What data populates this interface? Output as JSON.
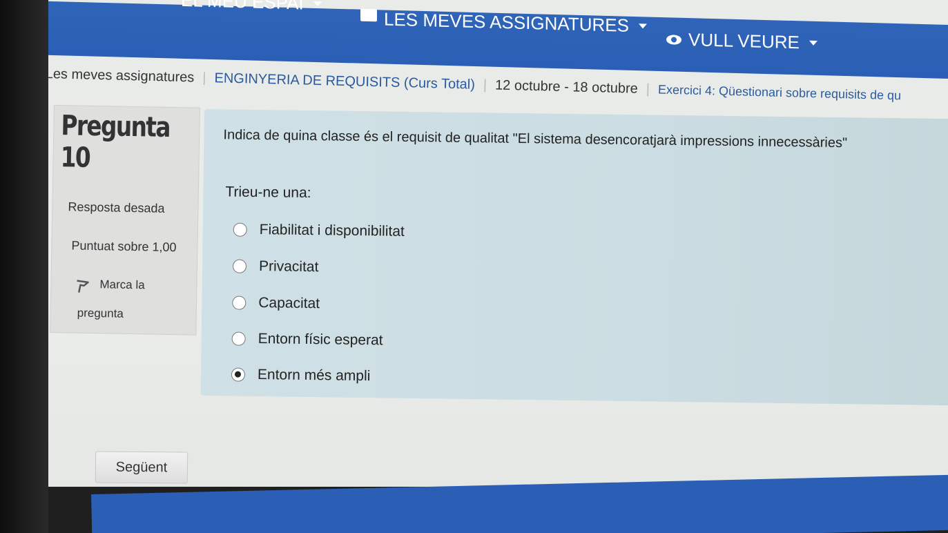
{
  "navbar": {
    "item_partial": "EL MEU ESPAI",
    "my_courses": "LES MEVES ASSIGNATURES",
    "view": "VULL VEURE",
    "brand_color": "#2f64b8"
  },
  "breadcrumb": [
    "Les meves assignatures",
    "ENGINYERIA DE REQUISITS (Curs Total)",
    "12 octubre - 18 octubre",
    "Exercici 4: Qüestionari sobre requisits de qu"
  ],
  "question_info": {
    "heading": "Pregunta",
    "number": "10",
    "status": "Resposta desada",
    "score": "Puntuat sobre 1,00",
    "flag_line1": "Marca la",
    "flag_line2": "pregunta"
  },
  "question": {
    "text": "Indica de quina classe és el requisit de qualitat \"El sistema desencoratjarà impressions innecessàries\"",
    "choose_label": "Trieu-ne una:",
    "options": [
      {
        "label": "Fiabilitat i disponibilitat",
        "selected": false
      },
      {
        "label": "Privacitat",
        "selected": false
      },
      {
        "label": "Capacitat",
        "selected": false
      },
      {
        "label": "Entorn físic esperat",
        "selected": false
      },
      {
        "label": "Entorn més ampli",
        "selected": true
      }
    ]
  },
  "navigation": {
    "next_label": "Següent"
  },
  "icons": {
    "calendar": "calendar-icon",
    "eye": "eye-icon",
    "flag": "flag-icon"
  }
}
